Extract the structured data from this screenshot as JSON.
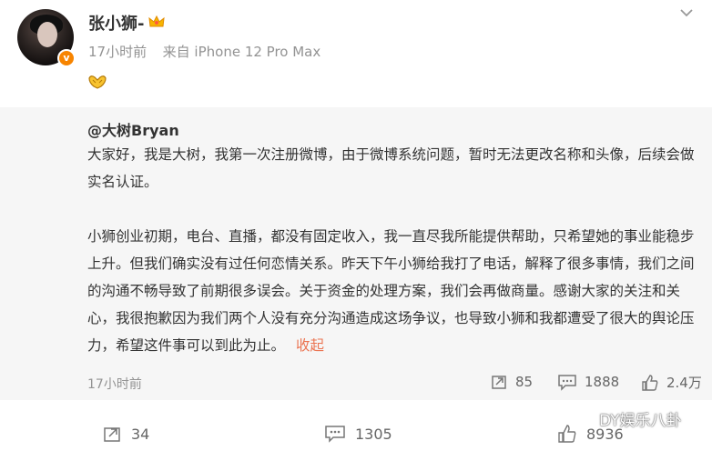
{
  "post": {
    "author": "张小狮-",
    "time": "17小时前",
    "source": "来自 iPhone 12 Pro Max",
    "verified_badge": "v"
  },
  "repost": {
    "author": "@大树Bryan",
    "paragraph1": "大家好，我是大树，我第一次注册微博，由于微博系统问题，暂时无法更改名称和头像，后续会做实名认证。",
    "paragraph2": "小狮创业初期，电台、直播，都没有固定收入，我一直尽我所能提供帮助，只希望她的事业能稳步上升。但我们确实没有过任何恋情关系。昨天下午小狮给我打了电话，解释了很多事情，我们之间的沟通不畅导致了前期很多误会。关于资金的处理方案，我们会再做商量。感谢大家的关注和关心，我很抱歉因为我们两个人没有充分沟通造成这场争议，也导致小狮和我都遭受了很大的舆论压力，希望这件事可以到此为止。",
    "collapse_label": "收起",
    "time": "17小时前",
    "reposts": "85",
    "comments": "1888",
    "likes": "2.4万"
  },
  "actions": {
    "reposts": "34",
    "comments": "1305",
    "likes": "8936"
  },
  "watermark": "DY娱乐八卦",
  "colors": {
    "accent": "#eb7350",
    "badge": "#f78400",
    "muted": "#939393",
    "repost_bg": "#f6f6f6"
  },
  "icons": [
    "chevron-down-icon",
    "crown-icon",
    "hands-emoji-icon",
    "repost-icon",
    "comment-icon",
    "like-icon",
    "wechat-icon"
  ]
}
